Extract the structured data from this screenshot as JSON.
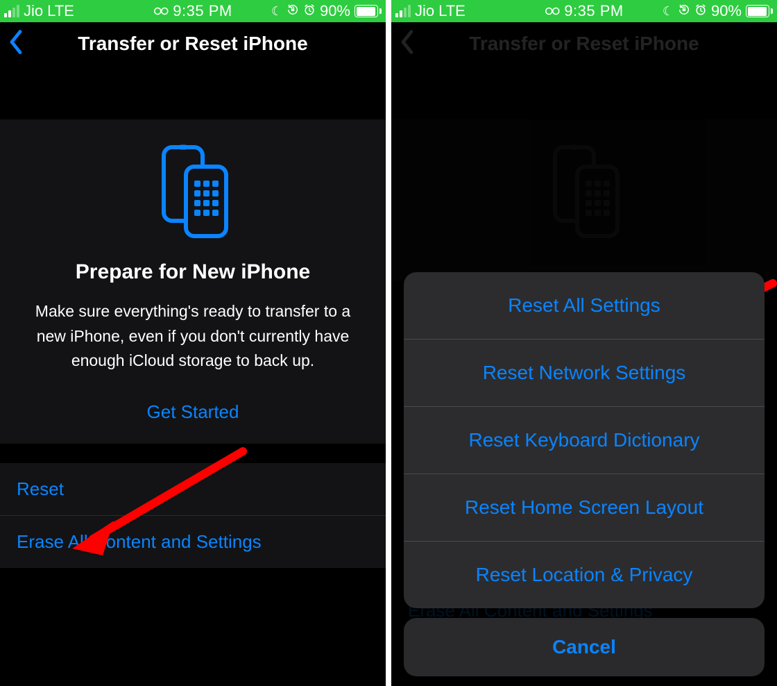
{
  "status": {
    "carrier": "Jio",
    "network": "LTE",
    "time": "9:35 PM",
    "battery_pct": "90%",
    "icons": {
      "moon": "☾",
      "lock": "",
      "alarm": ""
    }
  },
  "colors": {
    "accent": "#0a84ff",
    "status_bar": "#2ecc40",
    "bg": "#000000",
    "card_bg": "#131315",
    "sheet_bg": "#2c2c2e",
    "arrow": "#ff0000"
  },
  "left": {
    "nav_title": "Transfer or Reset iPhone",
    "card_title": "Prepare for New iPhone",
    "card_desc": "Make sure everything's ready to transfer to a new iPhone, even if you don't currently have enough iCloud storage to back up.",
    "get_started": "Get Started",
    "list": {
      "reset": "Reset",
      "erase": "Erase All Content and Settings"
    }
  },
  "right": {
    "nav_title": "Transfer or Reset iPhone",
    "underlying": {
      "erase": "Erase All Content and Settings"
    },
    "sheet": {
      "options": [
        "Reset All Settings",
        "Reset Network Settings",
        "Reset Keyboard Dictionary",
        "Reset Home Screen Layout",
        "Reset Location & Privacy"
      ],
      "cancel": "Cancel"
    }
  }
}
